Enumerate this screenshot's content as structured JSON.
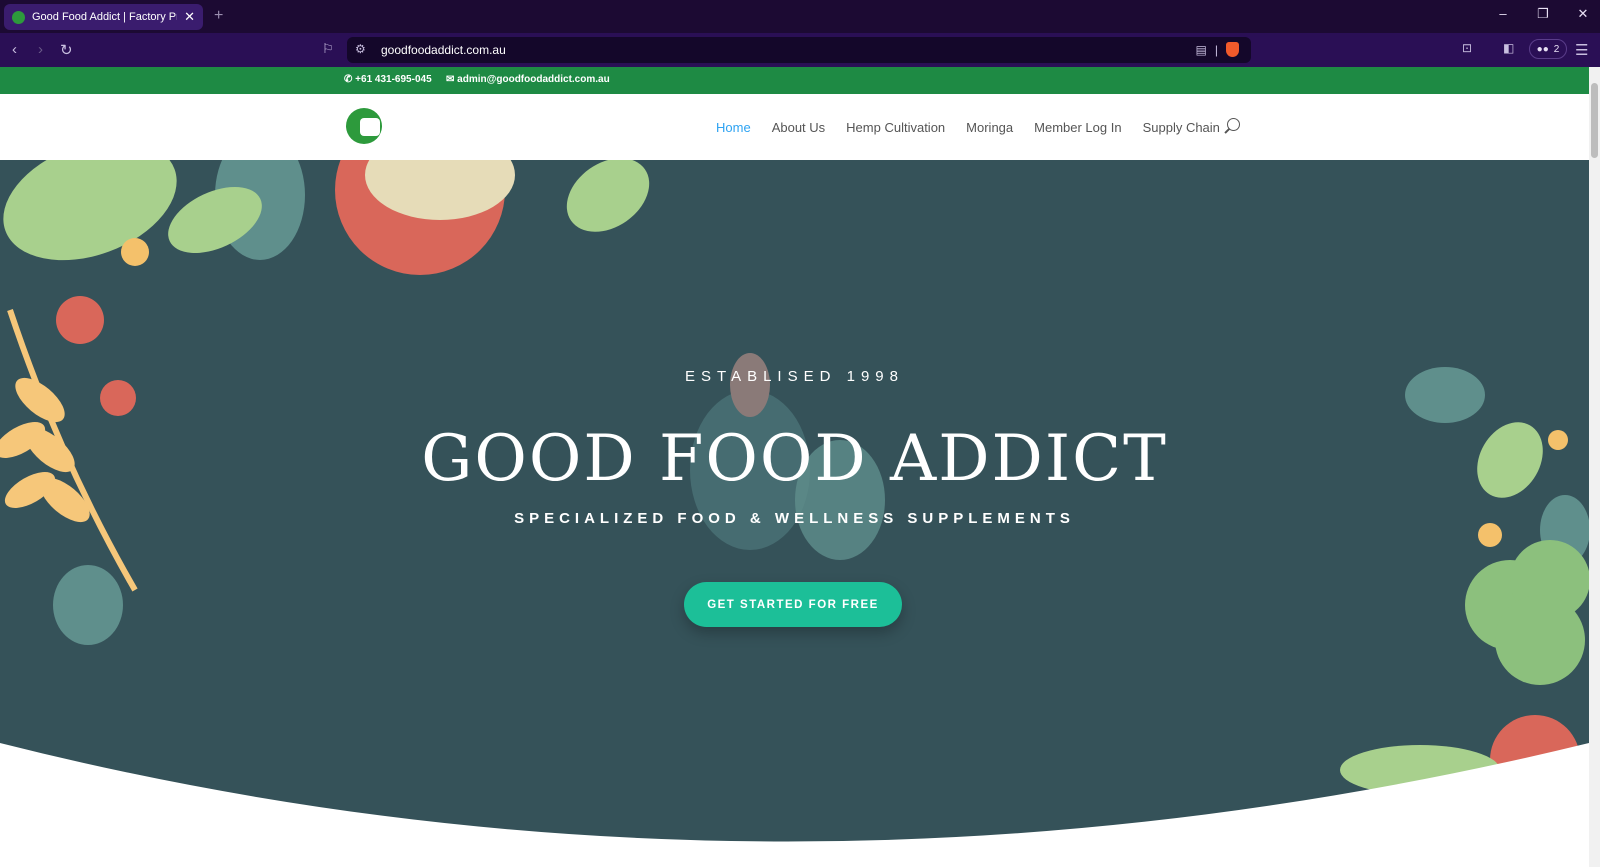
{
  "browser": {
    "tab_title": "Good Food Addict | Factory Price",
    "url": "goodfoodaddict.com.au",
    "extension_count": "2"
  },
  "topbar": {
    "phone": "+61 431-695-045",
    "email": "admin@goodfoodaddict.com.au"
  },
  "menu": {
    "items": [
      "Home",
      "About Us",
      "Hemp Cultivation",
      "Moringa",
      "Member Log In",
      "Supply Chain"
    ],
    "active": "Home"
  },
  "hero": {
    "established": "ESTABLISED 1998",
    "title": "GOOD FOOD ADDICT",
    "subtitle": "SPECIALIZED FOOD & WELLNESS SUPPLEMENTS",
    "cta_label": "GET STARTED FOR FREE"
  },
  "colors": {
    "topbar": "#1e8a44",
    "hero_bg": "#355259",
    "cta": "#1cbf98",
    "menu_active": "#2ea3f2"
  }
}
